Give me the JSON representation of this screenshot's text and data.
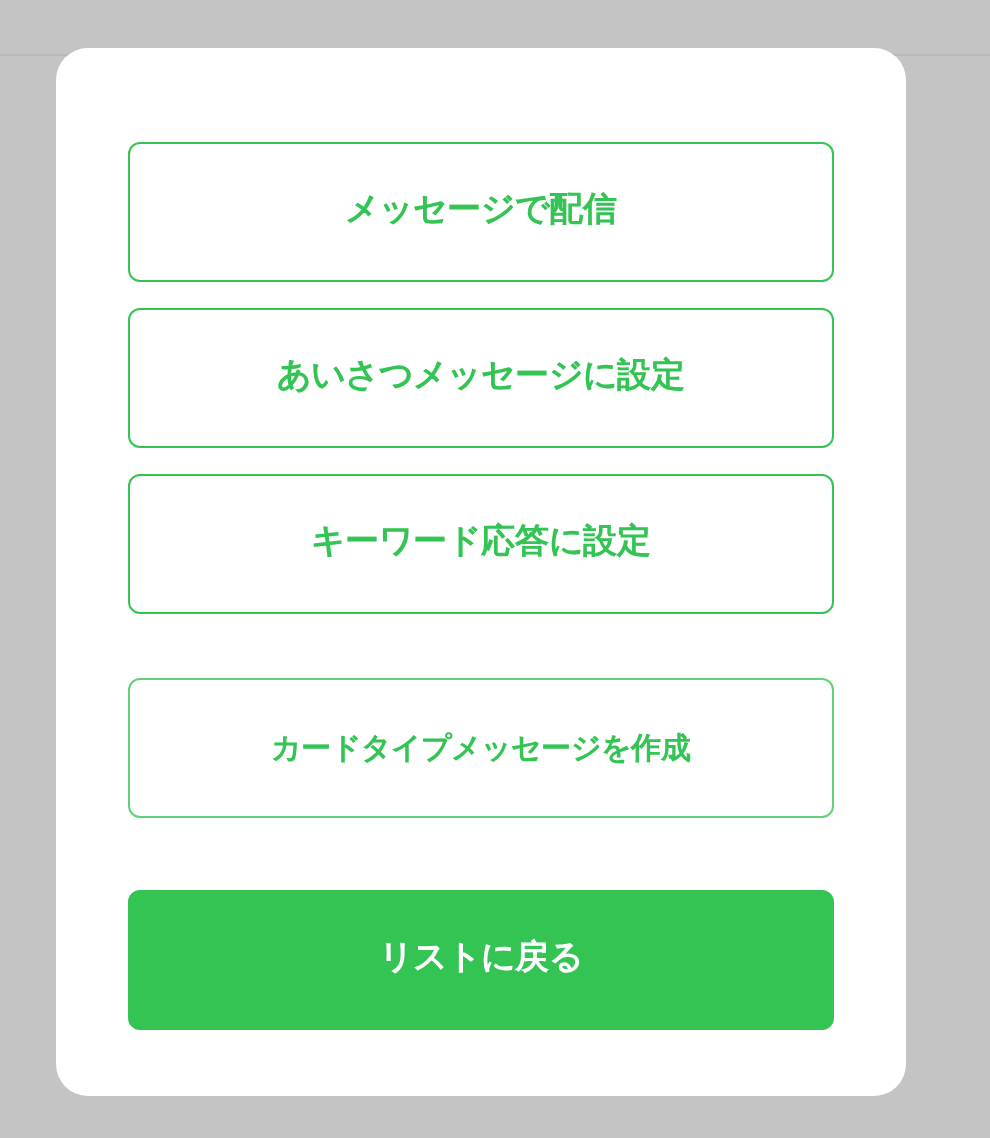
{
  "menu": {
    "actions": [
      {
        "label": "メッセージで配信",
        "kind": "outline"
      },
      {
        "label": "あいさつメッセージに設定",
        "kind": "outline"
      },
      {
        "label": "キーワード応答に設定",
        "kind": "outline"
      },
      {
        "label": "カードタイプメッセージを作成",
        "kind": "compact"
      },
      {
        "label": "リストに戻る",
        "kind": "filled"
      }
    ]
  }
}
